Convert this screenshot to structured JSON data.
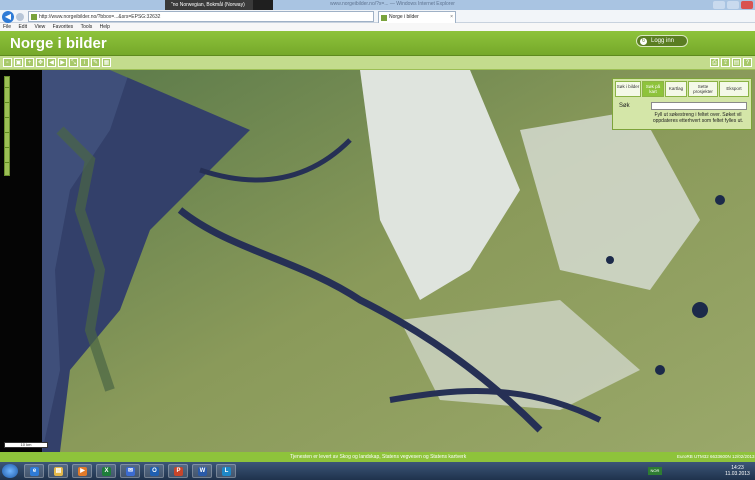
{
  "browser": {
    "window_title": "www.norgeibilder.no/?x=... — Windows Internet Explorer",
    "language_popup": "\"no Norwegian, Bokmål (Norway)",
    "language_help": "Help",
    "url": "http://www.norgeibilder.no/?bbox=...&srs=EPSG:32632",
    "tab_label": "Norge i bilder",
    "tab_close": "×",
    "back_glyph": "◀",
    "menu": [
      "File",
      "Edit",
      "View",
      "Favorites",
      "Tools",
      "Help"
    ]
  },
  "header": {
    "title": "Norge i bilder",
    "login_label": "Logg inn",
    "login_icon_glyph": "↻"
  },
  "toolbar": {
    "left_tools": [
      "new-icon",
      "select-icon",
      "zoom-in-icon",
      "pan-icon",
      "arrow-left-icon",
      "arrow-right-icon",
      "measure-icon",
      "info-icon",
      "draw-icon",
      "grid-icon"
    ],
    "right_tools": [
      "print-icon",
      "share-icon",
      "save-icon",
      "help-icon"
    ]
  },
  "panel": {
    "tabs": [
      "Søk i bilder",
      "Søk på kart",
      "Kartlag",
      "Sette prosjekter",
      "Eksport"
    ],
    "active_tab": 1,
    "search_label": "Søk",
    "search_value": "",
    "help_text": "Fyll ut søkestreng i feltet over. Søket vil oppdateres etterhvert som feltet fylles ut."
  },
  "map": {
    "scale_label": "10 km"
  },
  "footer": {
    "copyright": "Tjenesten er levert av Skog og landskap, Statens vegvesen og Statens kartverk",
    "coords": "EuroRB UTM32 6633600N 12/02/2013"
  },
  "taskbar": {
    "apps": [
      {
        "name": "ie",
        "glyph": "e",
        "color": "#2f7bd6"
      },
      {
        "name": "explorer",
        "glyph": "▤",
        "color": "#e4b84a"
      },
      {
        "name": "media",
        "glyph": "▶",
        "color": "#e07a2a"
      },
      {
        "name": "excel",
        "glyph": "X",
        "color": "#1e7e3a"
      },
      {
        "name": "chat",
        "glyph": "✉",
        "color": "#3b6bd0"
      },
      {
        "name": "outlook",
        "glyph": "O",
        "color": "#1f5fb0"
      },
      {
        "name": "powerpoint",
        "glyph": "P",
        "color": "#c8452a"
      },
      {
        "name": "word",
        "glyph": "W",
        "color": "#2a5aa8"
      },
      {
        "name": "lync",
        "glyph": "L",
        "color": "#1e88c7"
      }
    ],
    "keyboard_lang": "NOR",
    "time": "14:23",
    "date": "11.03.2013"
  }
}
